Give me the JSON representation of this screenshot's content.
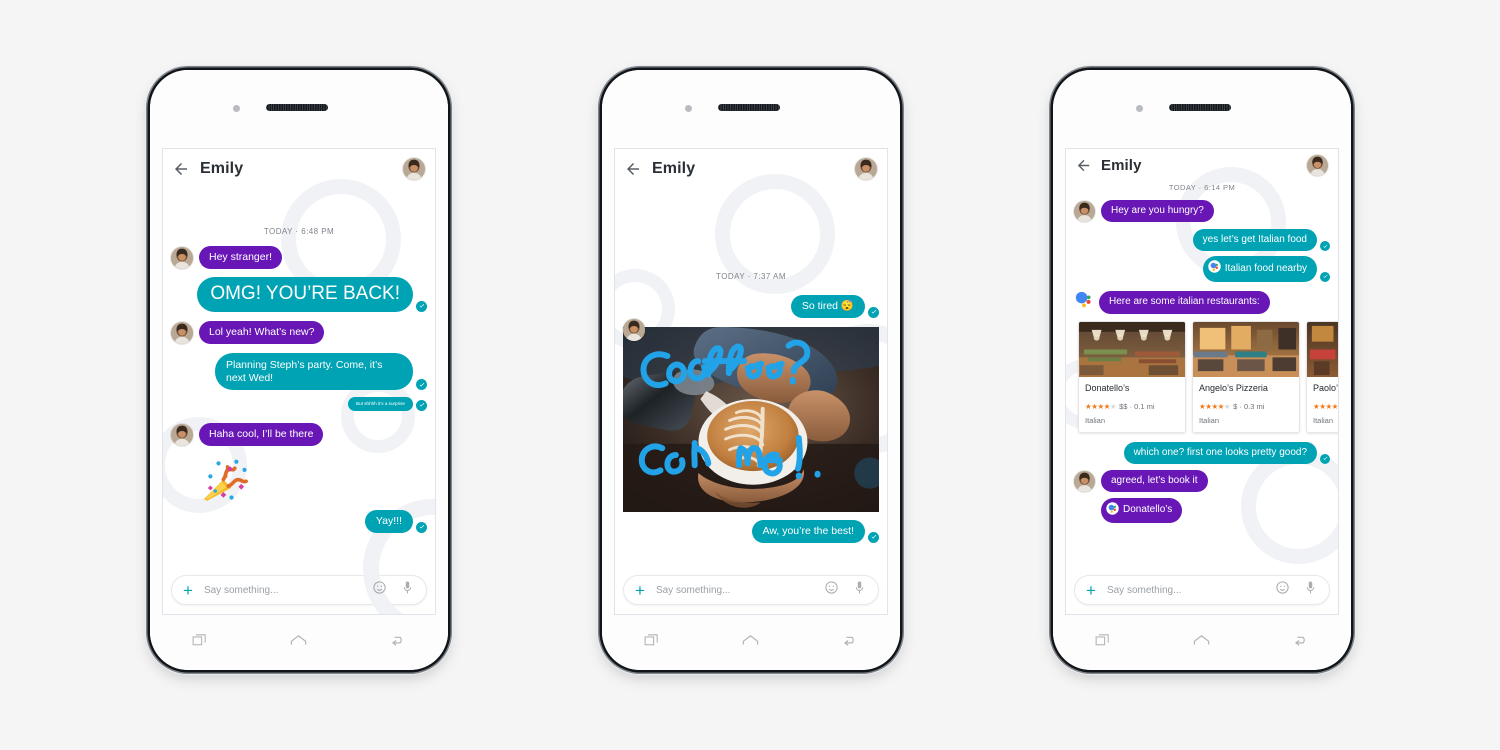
{
  "canvas": {
    "background": "#f5f5f5"
  },
  "theme": {
    "incoming_bubble": "#6817b6",
    "outgoing_bubble": "#00a3b4",
    "accent": "#00a3b4",
    "star": "#f07c1e",
    "timestamp_text": "#7e848c"
  },
  "phones": [
    {
      "id": "phone-1",
      "appbar": {
        "title": "Emily",
        "back_icon": "back-arrow-icon",
        "avatar": "contact-avatar"
      },
      "daystamp": "TODAY · 6:48 PM",
      "messages": [
        {
          "kind": "text",
          "dir": "in",
          "text": "Hey stranger!",
          "avatar": true,
          "size": "md"
        },
        {
          "kind": "text",
          "dir": "out",
          "text": "OMG! YOU’RE BACK!",
          "size": "xl",
          "tick": true
        },
        {
          "kind": "text",
          "dir": "in",
          "text": "Lol yeah! What’s new?",
          "avatar": true,
          "size": "md"
        },
        {
          "kind": "text",
          "dir": "out",
          "text": "Planning Steph’s party. Come, it’s next Wed!",
          "size": "md",
          "multiline": true,
          "tick": true
        },
        {
          "kind": "text",
          "dir": "out",
          "text": "But shhhh it’s a surprise",
          "size": "xs",
          "tick": true
        },
        {
          "kind": "text",
          "dir": "in",
          "text": "Haha cool, I’ll be there",
          "avatar": true,
          "size": "md"
        },
        {
          "kind": "emoji",
          "dir": "in",
          "text": "party-popper-emoji"
        },
        {
          "kind": "text",
          "dir": "out",
          "text": "Yay!!!",
          "size": "md",
          "tick": true
        }
      ],
      "composer": {
        "plus_label": "+",
        "placeholder": "Say something...",
        "emoji_icon": "emoji-icon",
        "mic_icon": "microphone-icon"
      },
      "navbar": {
        "recents_icon": "recents-icon",
        "home_icon": "home-icon",
        "back_icon": "back-icon"
      }
    },
    {
      "id": "phone-2",
      "appbar": {
        "title": "Emily",
        "back_icon": "back-arrow-icon",
        "avatar": "contact-avatar"
      },
      "daystamp": "TODAY · 7:37 AM",
      "messages": [
        {
          "kind": "text",
          "dir": "out",
          "text": "So tired 😴",
          "size": "md",
          "tick": true
        },
        {
          "kind": "photo",
          "dir": "in",
          "avatar": true,
          "caption_drawing": "Coffee? On me!.",
          "alt": "latte-art-photo"
        },
        {
          "kind": "text",
          "dir": "out",
          "text": "Aw, you’re the best!",
          "size": "md",
          "tick": true
        }
      ],
      "composer": {
        "plus_label": "+",
        "placeholder": "Say something...",
        "emoji_icon": "emoji-icon",
        "mic_icon": "microphone-icon"
      },
      "navbar": {
        "recents_icon": "recents-icon",
        "home_icon": "home-icon",
        "back_icon": "back-icon"
      }
    },
    {
      "id": "phone-3",
      "appbar": {
        "title": "Emily",
        "back_icon": "back-arrow-icon",
        "avatar": "contact-avatar"
      },
      "daystamp": "TODAY · 6:14 PM",
      "messages": [
        {
          "kind": "text",
          "dir": "in",
          "text": "Hey are you hungry?",
          "avatar": true,
          "size": "md"
        },
        {
          "kind": "text",
          "dir": "out",
          "text": "yes let’s get Italian food",
          "size": "md",
          "tick": true
        },
        {
          "kind": "text",
          "dir": "out",
          "text": "Italian food nearby",
          "size": "md",
          "tick": true,
          "assistant": true
        },
        {
          "kind": "text",
          "dir": "in",
          "text": "Here are some italian restaurants:",
          "size": "md",
          "assistant_sender": true
        },
        {
          "kind": "cards",
          "dir": "in"
        },
        {
          "kind": "text",
          "dir": "out",
          "text": "which one? first one looks pretty good?",
          "size": "md",
          "tick": true
        },
        {
          "kind": "text",
          "dir": "in",
          "text": "agreed, let’s book it",
          "avatar": true,
          "size": "md"
        },
        {
          "kind": "text",
          "dir": "in",
          "text": "Donatello’s",
          "size": "md",
          "assistant": true
        }
      ],
      "restaurants": [
        {
          "name": "Donatello’s",
          "stars": 4,
          "price": "$$",
          "distance": "0.1 mi",
          "category": "Italian"
        },
        {
          "name": "Angelo’s Pizzeria",
          "stars": 4,
          "price": "$",
          "distance": "0.3 mi",
          "category": "Italian"
        },
        {
          "name": "Paolo’s P",
          "stars": 4,
          "price": "",
          "distance": "",
          "category": "Italian"
        }
      ],
      "composer": {
        "plus_label": "+",
        "placeholder": "Say something...",
        "emoji_icon": "emoji-icon",
        "mic_icon": "microphone-icon"
      },
      "navbar": {
        "recents_icon": "recents-icon",
        "home_icon": "home-icon",
        "back_icon": "back-icon"
      }
    }
  ]
}
